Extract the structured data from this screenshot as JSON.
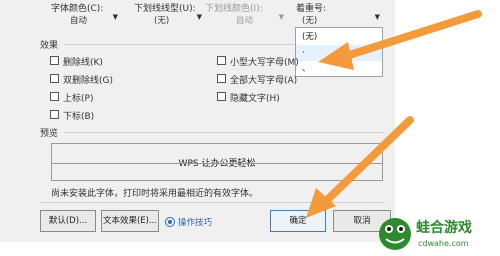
{
  "font_effects_row": {
    "color_label": "字体颜色(C):",
    "color_value": "自动",
    "underline_label": "下划线线型(U):",
    "underline_value": "(无)",
    "underline_color_label": "下划线颜色(I):",
    "underline_color_value": "自动",
    "emphasis_label": "着重号:",
    "emphasis_value": "(无)"
  },
  "emphasis_dropdown": {
    "options": [
      "(无)",
      "·",
      "、"
    ]
  },
  "effects": {
    "title": "效果",
    "left": [
      "删除线(K)",
      "双删除线(G)",
      "上标(P)",
      "下标(B)"
    ],
    "right": [
      "小型大写字母(M)",
      "全部大写字母(A)",
      "隐藏文字(H)"
    ]
  },
  "preview": {
    "title": "预览",
    "text": "WPS 让办公更轻松",
    "note": "尚未安装此字体，打印时将采用最相近的有效字体。"
  },
  "buttons": {
    "default": "默认(D)...",
    "text_effects": "文本效果(E)...",
    "help": "操作技巧",
    "ok": "确定",
    "cancel": "取消"
  },
  "watermark": {
    "name": "蛙合游戏",
    "url": "cdwahe.com"
  },
  "colors": {
    "arrow": "#f39a3a",
    "logo": "#2d8a2d"
  }
}
